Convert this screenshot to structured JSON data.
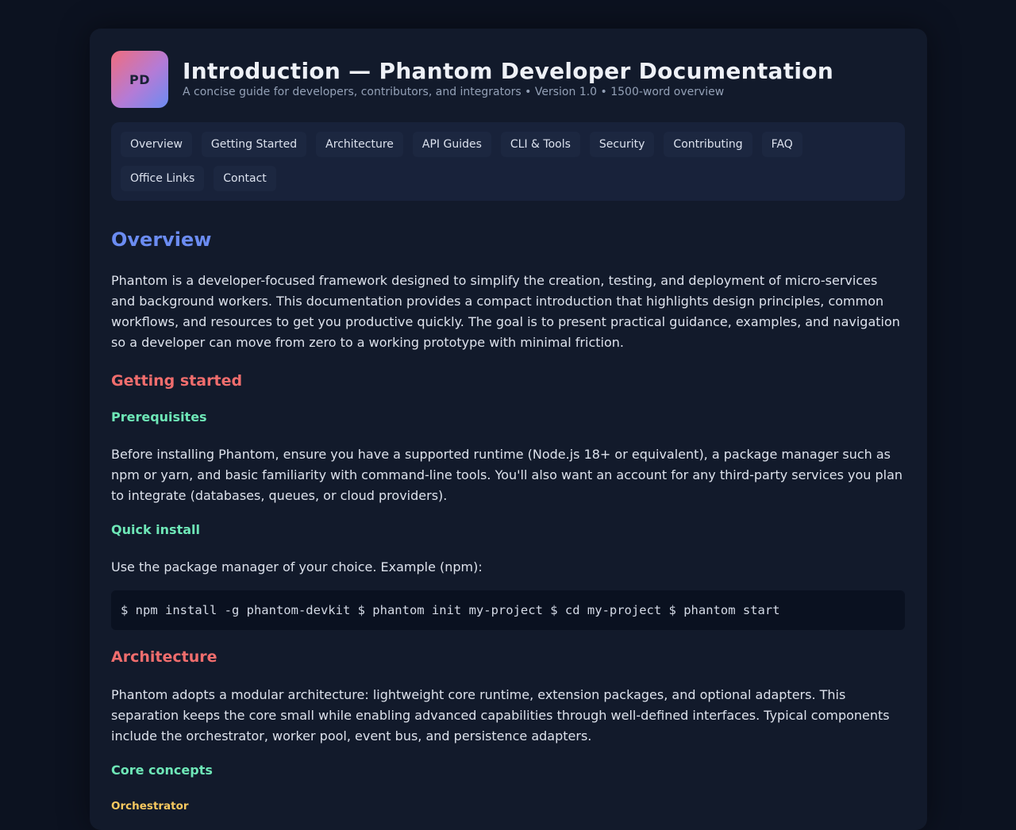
{
  "header": {
    "logo": "PD",
    "title": "Introduction — Phantom Developer Documentation",
    "subtitle": "A concise guide for developers, contributors, and integrators • Version 1.0 • 1500-word overview"
  },
  "nav": [
    "Overview",
    "Getting Started",
    "Architecture",
    "API Guides",
    "CLI & Tools",
    "Security",
    "Contributing",
    "FAQ",
    "Office Links",
    "Contact"
  ],
  "overview": {
    "heading": "Overview",
    "body": "Phantom is a developer-focused framework designed to simplify the creation, testing, and deployment of micro-services and background workers. This documentation provides a compact introduction that highlights design principles, common workflows, and resources to get you productive quickly. The goal is to present practical guidance, examples, and navigation so a developer can move from zero to a working prototype with minimal friction."
  },
  "getting_started": {
    "heading": "Getting started",
    "prereq_heading": "Prerequisites",
    "prereq_body": "Before installing Phantom, ensure you have a supported runtime (Node.js 18+ or equivalent), a package manager such as npm or yarn, and basic familiarity with command-line tools. You'll also want an account for any third-party services you plan to integrate (databases, queues, or cloud providers).",
    "install_heading": "Quick install",
    "install_body": "Use the package manager of your choice. Example (npm):",
    "install_code": "$ npm install -g phantom-devkit $ phantom init my-project $ cd my-project $ phantom start"
  },
  "architecture": {
    "heading": "Architecture",
    "body": "Phantom adopts a modular architecture: lightweight core runtime, extension packages, and optional adapters. This separation keeps the core small while enabling advanced capabilities through well-defined interfaces. Typical components include the orchestrator, worker pool, event bus, and persistence adapters.",
    "concepts_heading": "Core concepts",
    "orchestrator_heading": "Orchestrator"
  },
  "colors": {
    "accent_blue": "#6b8cf2",
    "accent_red": "#f06d6d",
    "accent_green": "#6ee7b7",
    "accent_yellow": "#f6c85f"
  }
}
